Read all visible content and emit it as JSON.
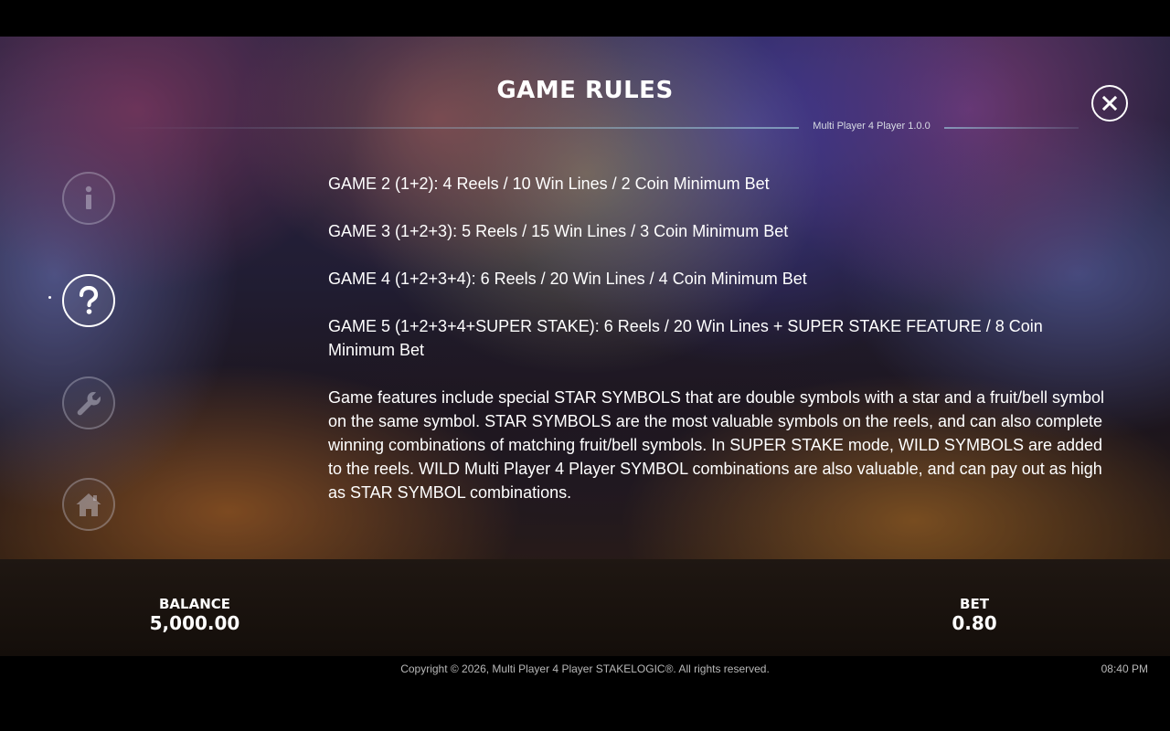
{
  "header": {
    "title": "GAME RULES",
    "version": "Multi Player 4 Player 1.0.0",
    "close_label": "X"
  },
  "sidebar": {
    "items": [
      {
        "name": "info",
        "icon": "info-icon",
        "active": false
      },
      {
        "name": "help",
        "icon": "question-icon",
        "active": true
      },
      {
        "name": "settings",
        "icon": "wrench-icon",
        "active": false
      },
      {
        "name": "home",
        "icon": "home-icon",
        "active": false
      }
    ]
  },
  "rules": {
    "paragraphs": [
      "GAME 2 (1+2): 4 Reels / 10 Win Lines / 2 Coin Minimum Bet",
      "GAME 3 (1+2+3): 5 Reels / 15 Win Lines / 3 Coin Minimum Bet",
      "GAME 4 (1+2+3+4): 6 Reels / 20 Win Lines / 4 Coin Minimum Bet",
      "GAME 5 (1+2+3+4+SUPER STAKE): 6 Reels / 20 Win Lines + SUPER STAKE FEATURE / 8 Coin Minimum Bet",
      "Game features include special STAR SYMBOLS that are double symbols with a star and a fruit/bell symbol on the same symbol. STAR SYMBOLS are the most valuable symbols on the reels, and can also complete winning combinations of matching fruit/bell symbols. In SUPER STAKE mode, WILD SYMBOLS are added to the reels. WILD Multi Player 4 Player SYMBOL combinations are also valuable, and can pay out as high as STAR SYMBOL combinations."
    ]
  },
  "status": {
    "balance_label": "BALANCE",
    "balance_value": "5,000.00",
    "bet_label": "BET",
    "bet_value": "0.80"
  },
  "footer": {
    "copyright": "Copyright © 2026, Multi Player 4 Player STAKELOGIC®. All rights reserved.",
    "time": "08:40 PM"
  },
  "colors": {
    "text": "#ffffff",
    "footer_text": "#b8b8b8",
    "bottom_bar": "#1a120d"
  }
}
